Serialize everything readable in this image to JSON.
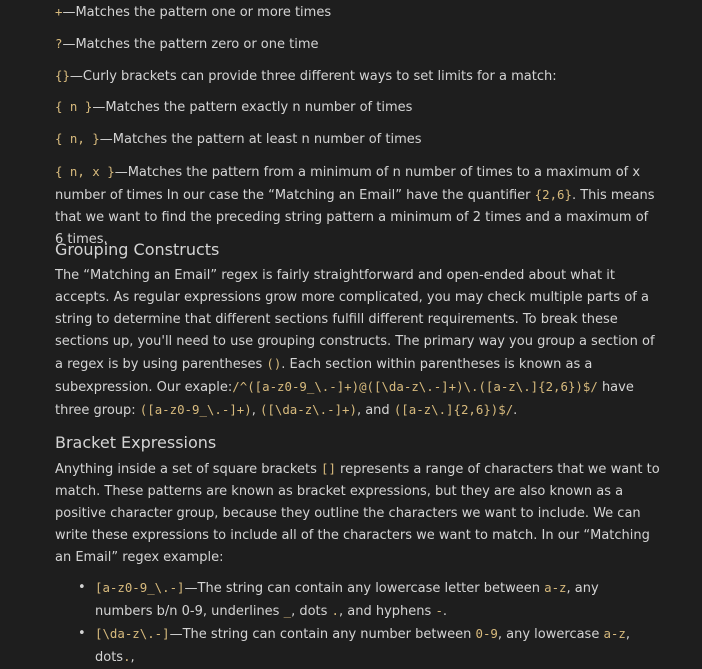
{
  "quantifiers": {
    "plus": {
      "code": "+",
      "text": "—Matches the pattern one or more times"
    },
    "question": {
      "code": "?",
      "text": "—Matches the pattern zero or one time"
    },
    "curly": {
      "code": "{}",
      "text": "—Curly brackets can provide three different ways to set limits for a match:"
    },
    "exact": {
      "code": "{ n }",
      "text": "—Matches the pattern exactly n number of times"
    },
    "atleast": {
      "code": "{ n, }",
      "text": "—Matches the pattern at least n number of times"
    },
    "range": {
      "code": "{ n, x }",
      "text_a": "—Matches the pattern from a minimum of n number of times to a maximum of x number of times In our case the “Matching an Email” have the quantifier ",
      "code_b": "{2,6}",
      "text_b": ". This means that we want to find the preceding string pattern a minimum of 2 times and a maximum of 6 times."
    }
  },
  "grouping": {
    "heading": "Grouping Constructs",
    "text_a": "The “Matching an Email” regex is fairly straightforward and open-ended about what it accepts. As regular expressions grow more complicated, you may check multiple parts of a string to determine that different sections fulfill different requirements. To break these sections up, you'll need to use grouping constructs. The primary way you group a section of a regex is by using parentheses ",
    "code_a": "()",
    "text_b": ". Each section within parentheses is known as a subexpression. Our exaple:",
    "code_b": "/^([a-z0-9_\\.-]+)@([\\da-z\\.-]+)\\.([a-z\\.]{2,6})$/",
    "text_c": " have three group: ",
    "code_c": "([a-z0-9_\\.-]+)",
    "text_d": ", ",
    "code_d": "([\\da-z\\.-]+)",
    "text_e": ", and ",
    "code_e": "([a-z\\.]{2,6})$/",
    "text_f": "."
  },
  "bracket": {
    "heading": "Bracket Expressions",
    "text_a": "Anything inside a set of square brackets ",
    "code_a": "[]",
    "text_b": " represents a range of characters that we want to match. These patterns are known as bracket expressions, but they are also known as a positive character group, because they outline the characters we want to include. We can write these expressions to include all of the characters we want to match. In our “Matching an Email” regex example:",
    "items": [
      {
        "code": "[a-z0-9_\\.-]",
        "text_a": "—The string can contain any lowercase letter between ",
        "code_a": "a-z",
        "text_b": ", any numbers b/n 0-9, underlines ",
        "code_b": "_",
        "text_c": ", dots ",
        "code_c": ".",
        "text_d": ", and hyphens ",
        "code_d": "-",
        "text_e": "."
      },
      {
        "code": "[\\da-z\\.-]",
        "text_a": "—The string can contain any number between ",
        "code_a": "0-9",
        "text_b": ", any lowercase ",
        "code_b": "a-z",
        "text_c": ", dots",
        "code_c": ".",
        "text_d": ",",
        "code_d": "",
        "text_e": ""
      }
    ]
  }
}
